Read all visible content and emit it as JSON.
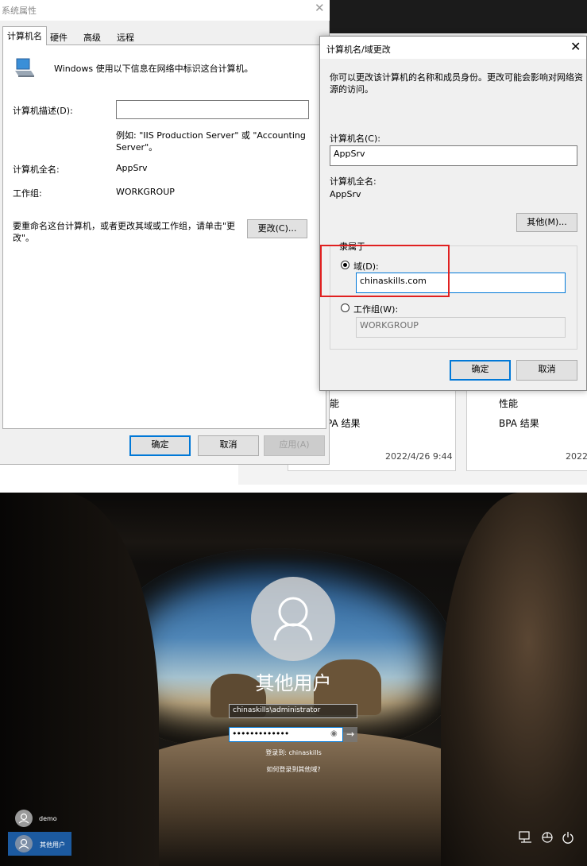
{
  "sys_properties": {
    "title": "系统属性",
    "tabs": [
      "计算机名",
      "硬件",
      "高级",
      "远程"
    ],
    "intro": "Windows 使用以下信息在网络中标识这台计算机。",
    "desc_label": "计算机描述(D):",
    "desc_value": "",
    "example_line1": "例如: \"IIS Production Server\" 或 \"Accounting",
    "example_line2": "Server\"。",
    "fullname_label": "计算机全名:",
    "fullname_value": "AppSrv",
    "workgroup_label": "工作组:",
    "workgroup_value": "WORKGROUP",
    "rename_line1": "要重命名这台计算机，或者更改其域或工作组，请单击\"更",
    "rename_line2": "改\"。",
    "change_button": "更改(C)...",
    "ok": "确定",
    "cancel": "取消",
    "apply": "应用(A)"
  },
  "computer_name_dialog": {
    "title": "计算机名/域更改",
    "close": "✕",
    "intro_line1": "你可以更改该计算机的名称和成员身份。更改可能会影响对网络资",
    "intro_line2": "源的访问。",
    "name_label": "计算机名(C):",
    "name_value": "AppSrv",
    "fullname_label": "计算机全名:",
    "fullname_value": "AppSrv",
    "more_button": "其他(M)...",
    "member_of_label": "隶属于",
    "domain_label": "域(D):",
    "domain_value": "chinaskills.com",
    "domain_selected": true,
    "workgroup_label": "工作组(W):",
    "workgroup_value": "WORKGROUP",
    "ok": "确定",
    "cancel": "取消"
  },
  "background_tiles": [
    {
      "line1": "能",
      "line2": "PA 结果",
      "timestamp": "2022/4/26 9:44"
    },
    {
      "line1": "性能",
      "line2": "BPA 结果",
      "timestamp": "2022/"
    }
  ],
  "login_screen": {
    "user_display_name": "其他用户",
    "username_value": "chinaskills\\administrator",
    "password_mask": "•••••••••••••",
    "password_reveal_icon": "eye-icon",
    "submit_glyph": "→",
    "sign_in_to": "登录到: chinaskills",
    "other_domain_link": "如何登录到其他域?",
    "users": [
      {
        "name": "demo",
        "selected": false
      },
      {
        "name": "其他用户",
        "selected": true
      }
    ],
    "bottom_icons": [
      "network-icon",
      "accessibility-icon",
      "power-icon"
    ]
  },
  "colors": {
    "accent": "#0078d7",
    "highlight_box": "#e02020",
    "selected_user_bg": "#1c5aa0"
  }
}
